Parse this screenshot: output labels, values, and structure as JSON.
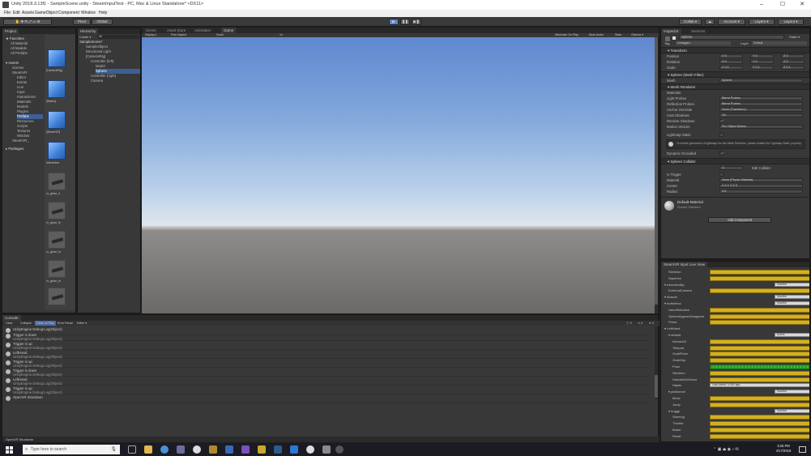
{
  "window": {
    "title": "Unity 2018.3.13f1 - SampleScene.unity - SteamInputTest - PC, Mac & Linux Standalone* <DX11>",
    "minimize": "–",
    "maximize": "☐",
    "close": "✕"
  },
  "menu": [
    "File",
    "Edit",
    "Assets",
    "GameObject",
    "Component",
    "Window",
    "Help"
  ],
  "toolbar": {
    "pivot": "Pivot",
    "global": "Global",
    "play": "▶",
    "pause": "❚❚",
    "step": "▶❚",
    "collab": "Collab ▾",
    "account": "Account ▾",
    "layers": "Layers ▾",
    "layout": "Layout ▾"
  },
  "project": {
    "tabs": [
      "Project"
    ],
    "favorites_header": "Favorites",
    "favorites": [
      "All Material",
      "All Models",
      "All Prefabs"
    ],
    "assets_header": "Assets",
    "assets": [
      "Scenes",
      "SteamVR",
      "Editor",
      "Extras",
      "Icon",
      "Input",
      "InteractionS",
      "Materials",
      "Models",
      "Plugins",
      "Prefabs",
      "Resources",
      "Scripts",
      "Textures",
      "Window"
    ],
    "steamvr_item": "SteamVR_",
    "packages_header": "Packages",
    "breadcrumb": "Assets > SteamVR > Prefabs",
    "thumb_labels": [
      "[CameraRig]",
      "[Status]",
      "[SteamVR]",
      "Interaction",
      "vr_glove_ri",
      "vr_glove_le",
      "vr_glove_m",
      "vr_glove_m",
      "vr_glove_m"
    ]
  },
  "hierarchy": {
    "tab": "Hierarchy",
    "create": "Create ▾",
    "search": "All",
    "items": [
      {
        "label": "SampleScene*",
        "indent": 0
      },
      {
        "label": "SampleObject",
        "indent": 1
      },
      {
        "label": "Directional Light",
        "indent": 1
      },
      {
        "label": "[CameraRig]",
        "indent": 1
      },
      {
        "label": "Controller (left)",
        "indent": 2
      },
      {
        "label": "Model",
        "indent": 3
      },
      {
        "label": "Sphere",
        "indent": 3
      },
      {
        "label": "Controller (right)",
        "indent": 2
      },
      {
        "label": "Camera",
        "indent": 2
      }
    ]
  },
  "center_tabs": [
    "Scene",
    "Asset Store",
    "Animation",
    "Game"
  ],
  "game_toolbar": {
    "display": "Display 1",
    "aspect": "Free Aspect",
    "scale_label": "Scale",
    "scale_value": "1x",
    "maximize": "Maximize On Play",
    "mute": "Mute Audio",
    "stats": "Stats",
    "gizmos": "Gizmos ▾"
  },
  "console": {
    "tab": "Console",
    "buttons": [
      "Clear",
      "Collapse",
      "Clear on Play",
      "Error Pause",
      "Editor ▾"
    ],
    "count_info": "9",
    "count_warn": "0",
    "count_err": "0",
    "entries": [
      {
        "l1": "UnityEngine.Debug:Log(Object)",
        "l2": ""
      },
      {
        "l1": "Trigger is down",
        "l2": "UnityEngine.Debug:Log(Object)"
      },
      {
        "l1": "Trigger is up",
        "l2": "UnityEngine.Debug:Log(Object)"
      },
      {
        "l1": "LeftHand",
        "l2": "UnityEngine.Debug:Log(Object)"
      },
      {
        "l1": "Trigger is up",
        "l2": "UnityEngine.Debug:Log(Object)"
      },
      {
        "l1": "Trigger is down",
        "l2": "UnityEngine.Debug:Log(Object)"
      },
      {
        "l1": "LeftHand",
        "l2": "UnityEngine.Debug:Log(Object)"
      },
      {
        "l1": "Trigger is up",
        "l2": "UnityEngine.Debug:Log(Object)"
      },
      {
        "l1": "OpenVR Shutdown",
        "l2": ""
      }
    ],
    "status": "OpenVR Shutdown"
  },
  "inspector": {
    "tabs": [
      "Inspector",
      "Services"
    ],
    "object_name": "Sphere",
    "static": "Static ▾",
    "tag_label": "Tag",
    "tag_value": "Untagged",
    "layer_label": "Layer",
    "layer_value": "Default",
    "transform": {
      "header": "Transform",
      "rows": [
        {
          "label": "Position",
          "x": "0",
          "y": "0",
          "z": "0"
        },
        {
          "label": "Rotation",
          "x": "0",
          "y": "0",
          "z": "0"
        },
        {
          "label": "Scale",
          "x": "0.1",
          "y": "0.1",
          "z": "0.1"
        }
      ]
    },
    "mesh_filter": {
      "header": "Sphere (Mesh Filter)",
      "mesh_label": "Mesh",
      "mesh_value": "Sphere"
    },
    "mesh_renderer": {
      "header": "Mesh Renderer",
      "rows": [
        {
          "label": "Materials",
          "value": ""
        },
        {
          "label": "Light Probes",
          "value": "Blend Probes"
        },
        {
          "label": "Reflection Probes",
          "value": "Blend Probes"
        },
        {
          "label": "Anchor Override",
          "value": "None (Transform)"
        },
        {
          "label": "Cast Shadows",
          "value": "On"
        },
        {
          "label": "Receive Shadows",
          "value": "✓"
        },
        {
          "label": "Motion Vectors",
          "value": "Per Object Motion"
        },
        {
          "label": "Lightmap Static",
          "value": ""
        }
      ],
      "info": "To enable generation of lightmaps for this Mesh Renderer, please enable the 'Lightmap Static' property.",
      "dynamic_occluded": "Dynamic Occluded"
    },
    "sphere_collider": {
      "header": "Sphere Collider",
      "edit": "Edit Collider",
      "rows": [
        {
          "label": "Is Trigger",
          "value": ""
        },
        {
          "label": "Material",
          "value": "None (Physic Material)"
        },
        {
          "label": "Center",
          "value": "X 0   Y 0   Z 0"
        },
        {
          "label": "Radius",
          "value": "0.5"
        }
      ]
    },
    "material": {
      "name": "Default-Material",
      "shader": "Shader  Standard"
    },
    "add_component": "Add Component"
  },
  "steamvr_input": {
    "tab": "SteamVR Input Live View",
    "rows": [
      {
        "label": "Skeleton",
        "indent": 1,
        "kind": "bar"
      },
      {
        "label": "Squeeze",
        "indent": 1,
        "kind": "bar"
      },
      {
        "label": "▾ mixedreality",
        "indent": 0,
        "kind": "dd",
        "dd": "Inactive"
      },
      {
        "label": "ExternalCamera",
        "indent": 1,
        "kind": "bar"
      },
      {
        "label": "▾ Muscle",
        "indent": 0,
        "kind": "dd",
        "dd": "Inactive"
      },
      {
        "label": "▾ buttonbuc",
        "indent": 0,
        "kind": "dd",
        "dd": "Inactive"
      },
      {
        "label": "HandSelection",
        "indent": 1,
        "kind": "bar"
      },
      {
        "label": "SphereAppearDisappear",
        "indent": 1,
        "kind": "bar"
      },
      {
        "label": "Press",
        "indent": 1,
        "kind": "bar"
      },
      {
        "label": "▾ LeftHand",
        "indent": 0,
        "kind": "none"
      },
      {
        "label": "▾ default",
        "indent": 1,
        "kind": "dd",
        "dd": "Active"
      },
      {
        "label": "InteractUI",
        "indent": 2,
        "kind": "bar"
      },
      {
        "label": "Teleport",
        "indent": 2,
        "kind": "bar"
      },
      {
        "label": "GrabPinch",
        "indent": 2,
        "kind": "bar"
      },
      {
        "label": "GrabGrip",
        "indent": 2,
        "kind": "bar"
      },
      {
        "label": "Pose",
        "indent": 2,
        "kind": "green"
      },
      {
        "label": "Skeleton",
        "indent": 2,
        "kind": "bar"
      },
      {
        "label": "HeadsetOnHead",
        "indent": 2,
        "kind": "bar"
      },
      {
        "label": "Haptic",
        "indent": 2,
        "kind": "dd",
        "dd": "Last Active: 0.000 ago"
      },
      {
        "label": "▾ platformer",
        "indent": 1,
        "kind": "dd",
        "dd": "Inactive"
      },
      {
        "label": "Move",
        "indent": 2,
        "kind": "bar"
      },
      {
        "label": "Jump",
        "indent": 2,
        "kind": "bar"
      },
      {
        "label": "▾ buggy",
        "indent": 1,
        "kind": "dd",
        "dd": "Inactive"
      },
      {
        "label": "Steering",
        "indent": 2,
        "kind": "bar"
      },
      {
        "label": "Throttle",
        "indent": 2,
        "kind": "bar"
      },
      {
        "label": "Brake",
        "indent": 2,
        "kind": "bar"
      },
      {
        "label": "Reset",
        "indent": 2,
        "kind": "bar"
      }
    ]
  },
  "taskbar": {
    "search_placeholder": "Type here to search",
    "time": "3:25 PM",
    "date": "4/17/2019"
  },
  "colors": {
    "accent": "#3e5f96",
    "bar_yellow": "#d4b020",
    "bar_green": "#3cc43c",
    "panel": "#383838"
  }
}
